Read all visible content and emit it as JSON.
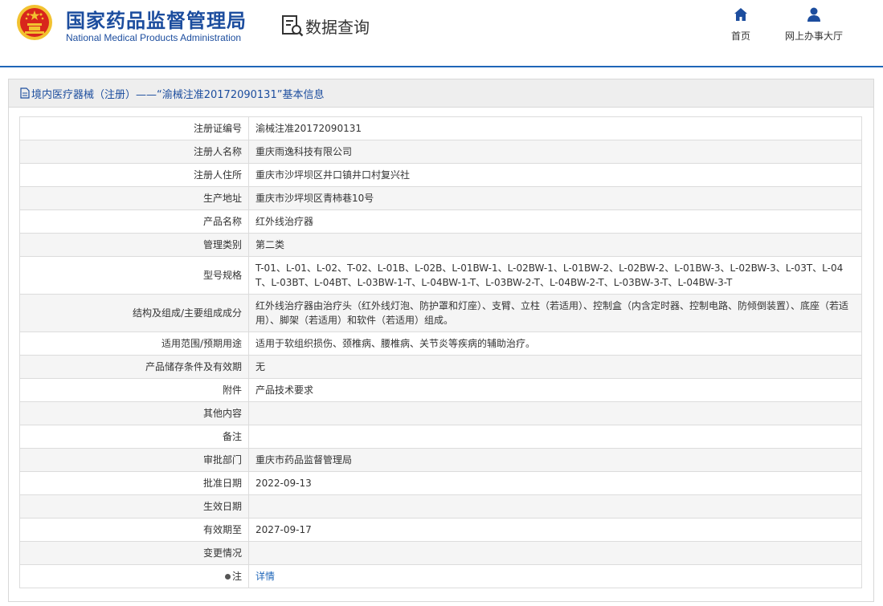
{
  "header": {
    "brand_cn": "国家药品监督管理局",
    "brand_en": "National Medical Products Administration",
    "query_label": "数据查询",
    "nav": {
      "home": "首页",
      "office": "网上办事大厅"
    }
  },
  "panel": {
    "title": "境内医疗器械（注册）——“渝械注准20172090131”基本信息"
  },
  "rows": [
    {
      "label": "注册证编号",
      "value": "渝械注准20172090131"
    },
    {
      "label": "注册人名称",
      "value": "重庆雨逸科技有限公司"
    },
    {
      "label": "注册人住所",
      "value": "重庆市沙坪坝区井口镇井口村复兴社"
    },
    {
      "label": "生产地址",
      "value": "重庆市沙坪坝区青柿巷10号"
    },
    {
      "label": "产品名称",
      "value": "红外线治疗器"
    },
    {
      "label": "管理类别",
      "value": "第二类"
    },
    {
      "label": "型号规格",
      "value": "T-01、L-01、L-02、T-02、L-01B、L-02B、L-01BW-1、L-02BW-1、L-01BW-2、L-02BW-2、L-01BW-3、L-02BW-3、L-03T、L-04T、L-03BT、L-04BT、L-03BW-1-T、L-04BW-1-T、L-03BW-2-T、L-04BW-2-T、L-03BW-3-T、L-04BW-3-T"
    },
    {
      "label": "结构及组成/主要组成成分",
      "value": "红外线治疗器由治疗头（红外线灯泡、防护罩和灯座）、支臂、立柱（若适用）、控制盒（内含定时器、控制电路、防倾倒装置）、底座（若适用）、脚架（若适用）和软件（若适用）组成。"
    },
    {
      "label": "适用范围/预期用途",
      "value": "适用于软组织损伤、颈椎病、腰椎病、关节炎等疾病的辅助治疗。"
    },
    {
      "label": "产品储存条件及有效期",
      "value": "无"
    },
    {
      "label": "附件",
      "value": "产品技术要求"
    },
    {
      "label": "其他内容",
      "value": ""
    },
    {
      "label": "备注",
      "value": ""
    },
    {
      "label": "审批部门",
      "value": "重庆市药品监督管理局"
    },
    {
      "label": "批准日期",
      "value": "2022-09-13"
    },
    {
      "label": "生效日期",
      "value": ""
    },
    {
      "label": "有效期至",
      "value": "2027-09-17"
    },
    {
      "label": "变更情况",
      "value": ""
    }
  ],
  "note": {
    "label": "注",
    "link": "详情"
  },
  "colors": {
    "brand_blue": "#1c4d9e",
    "link_blue": "#1f66b8",
    "emblem_red": "#d8261c",
    "emblem_gold": "#f2c230"
  }
}
